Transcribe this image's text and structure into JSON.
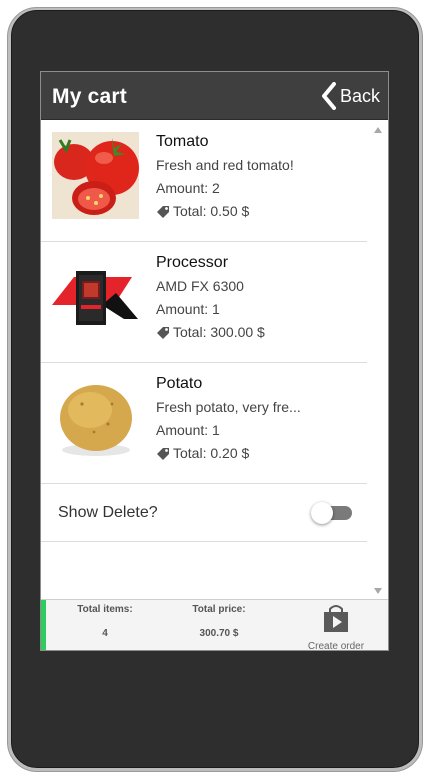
{
  "header": {
    "title": "My cart",
    "back_label": "Back"
  },
  "items": [
    {
      "name": "Tomato",
      "description": "Fresh and red tomato!",
      "amount": "Amount: 2",
      "total": "Total: 0.50 $",
      "image": "tomato-image"
    },
    {
      "name": "Processor",
      "description": "AMD FX 6300",
      "amount": "Amount: 1",
      "total": "Total: 300.00 $",
      "image": "amd-processor-image"
    },
    {
      "name": "Potato",
      "description": "Fresh potato, very fre...",
      "amount": "Amount: 1",
      "total": "Total: 0.20 $",
      "image": "potato-image"
    }
  ],
  "delete_toggle": {
    "label": "Show Delete?",
    "on": false
  },
  "footer": {
    "total_items_label": "Total items:",
    "total_items_value": "4",
    "total_price_label": "Total price:",
    "total_price_value": "300.70 $",
    "create_order_label": "Create order"
  },
  "colors": {
    "header_bg": "#3f3f3f",
    "accent_green": "#2ecc5f",
    "toggle_track": "#7a7a7a",
    "phone_body": "#2e2e2e"
  }
}
